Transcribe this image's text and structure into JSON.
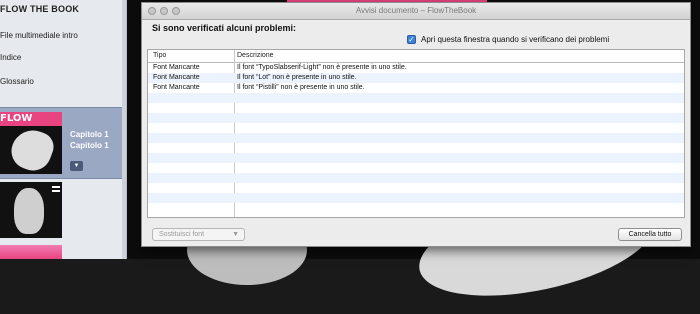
{
  "sidebar": {
    "book_title": "FLOW THE BOOK",
    "items": [
      {
        "label": "File multimediale intro"
      },
      {
        "label": "Indice"
      },
      {
        "label": "Glossario"
      }
    ],
    "chapter": {
      "thumb_text": "FLOW",
      "label_1": "Capitolo 1",
      "label_2": "Capitolo 1",
      "arrow_icon": "chevron-down-icon"
    }
  },
  "dialog": {
    "title": "Avvisi documento – FlowTheBook",
    "heading": "Si sono verificati alcuni problemi:",
    "checkbox": {
      "label": "Apri questa finestra quando si verificano dei problemi",
      "checked": true
    },
    "table": {
      "columns": [
        "Tipo",
        "Descrizione"
      ],
      "rows": [
        {
          "type": "Font Mancante",
          "description": "Il font “TypoSlabserif-Light” non è presente in uno stile."
        },
        {
          "type": "Font Mancante",
          "description": "Il font “Lot” non è presente in uno stile."
        },
        {
          "type": "Font Mancante",
          "description": "Il font “Pistilli” non è presente in uno stile."
        }
      ]
    },
    "replace_dropdown": {
      "label": "Sostituisci font",
      "enabled": false
    },
    "clear_button": {
      "label": "Cancella tutto"
    }
  },
  "colors": {
    "accent_pink": "#e8447f",
    "selection_blue": "#9aa8c4",
    "checkbox_blue": "#3b82d8"
  }
}
